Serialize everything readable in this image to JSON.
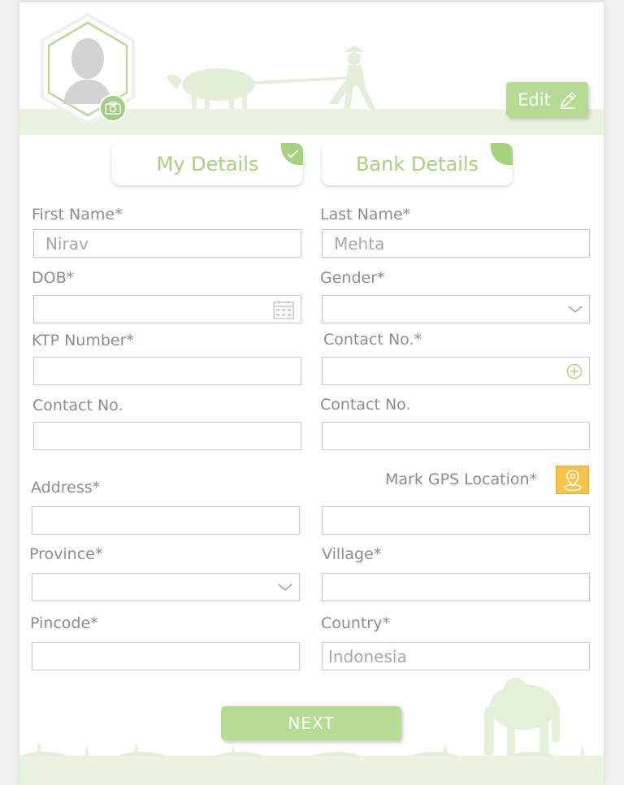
{
  "profile": {
    "edit_label": "Edit"
  },
  "tabs": [
    {
      "label": "My Details",
      "completed": true
    },
    {
      "label": "Bank Details",
      "completed": false
    }
  ],
  "form": {
    "first_name": {
      "label": "First Name*",
      "value": "Nirav"
    },
    "last_name": {
      "label": "Last Name*",
      "value": "Mehta"
    },
    "dob": {
      "label": "DOB*",
      "value": "",
      "icon": "calendar-icon"
    },
    "gender": {
      "label": "Gender*",
      "value": "",
      "icon": "chevron-down-icon"
    },
    "ktp_number": {
      "label": "KTP Number*",
      "value": ""
    },
    "contact_primary": {
      "label": "Contact No.*",
      "value": "",
      "icon": "add-circle-icon"
    },
    "contact_2": {
      "label": "Contact No.",
      "value": ""
    },
    "contact_3": {
      "label": "Contact No.",
      "value": ""
    },
    "address": {
      "label": "Address*",
      "value": ""
    },
    "gps": {
      "label": "Mark GPS Location*",
      "value": "",
      "icon": "map-pin-icon"
    },
    "province": {
      "label": "Province*",
      "value": "",
      "icon": "chevron-down-icon"
    },
    "village": {
      "label": "Village*",
      "value": ""
    },
    "pincode": {
      "label": "Pincode*",
      "value": ""
    },
    "country": {
      "label": "Country*",
      "value": "Indonesia"
    }
  },
  "actions": {
    "next_label": "NEXT"
  },
  "colors": {
    "accent_green": "#a6d27f",
    "button_green": "#b5dc92",
    "gps_yellow": "#f6c44d",
    "label_gray": "#8d8d8d"
  }
}
